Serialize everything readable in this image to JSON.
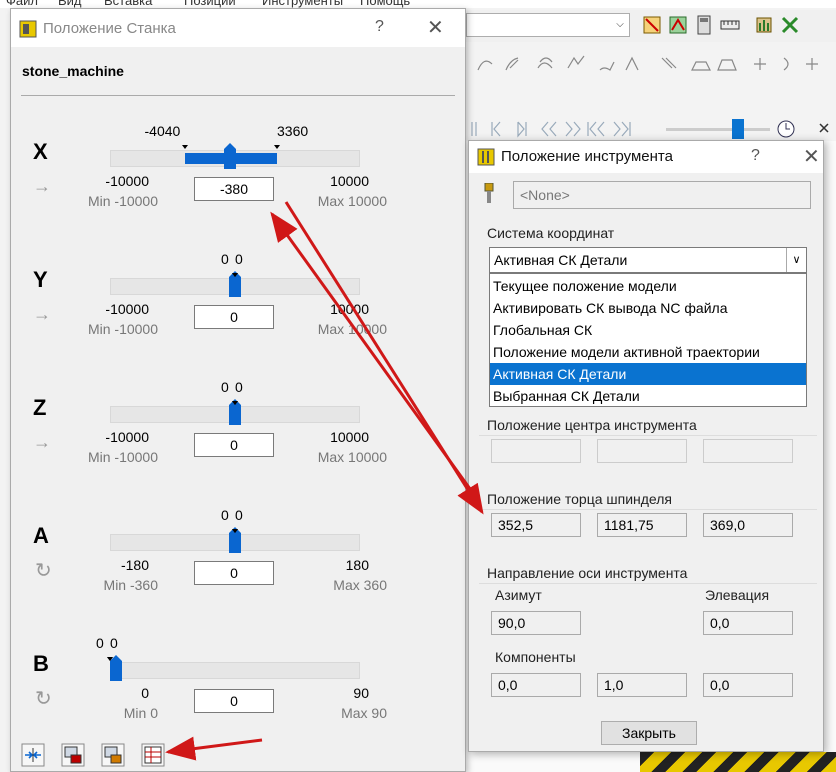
{
  "colors": {
    "accent": "#0a66d0",
    "selection": "#0a73d0",
    "arrow": "#d01818"
  },
  "background_app": {
    "menu_items": [
      "Файл",
      "Вид",
      "Вставка",
      "Позиции",
      "Инструменты",
      "Помощь"
    ]
  },
  "machine_dialog": {
    "title": "Положение Станка",
    "help": "?",
    "close": "✕",
    "machine_name": "stone_machine",
    "axes": [
      {
        "name": "X",
        "kind": "linear",
        "range_low": "-4040",
        "range_high": "3360",
        "limit_low": "-10000",
        "limit_high": "10000",
        "min_label": "Min -10000",
        "max_label": "Max 10000",
        "value": "-380",
        "value_num": -380,
        "min": -10000,
        "max": 10000,
        "range_low_num": -4040,
        "range_high_num": 3360
      },
      {
        "name": "Y",
        "kind": "linear",
        "range_low": "0",
        "range_high": "0",
        "limit_low": "-10000",
        "limit_high": "10000",
        "min_label": "Min -10000",
        "max_label": "Max 10000",
        "value": "0",
        "value_num": 0,
        "min": -10000,
        "max": 10000
      },
      {
        "name": "Z",
        "kind": "linear",
        "range_low": "0",
        "range_high": "0",
        "limit_low": "-10000",
        "limit_high": "10000",
        "min_label": "Min -10000",
        "max_label": "Max 10000",
        "value": "0",
        "value_num": 0,
        "min": -10000,
        "max": 10000
      },
      {
        "name": "A",
        "kind": "rotary",
        "range_low": "0",
        "range_high": "0",
        "limit_low": "-180",
        "limit_high": "180",
        "min_label": "Min -360",
        "max_label": "Max 360",
        "value": "0",
        "value_num": 0,
        "min": -180,
        "max": 180
      },
      {
        "name": "B",
        "kind": "rotary",
        "range_low": "0",
        "range_high": "0",
        "limit_low": "0",
        "limit_high": "90",
        "min_label": "Min 0",
        "max_label": "Max 90",
        "value": "0",
        "value_num": 0,
        "min": 0,
        "max": 90
      }
    ],
    "bottom_buttons": [
      "align-icon",
      "machine-to-model-icon",
      "model-to-machine-icon",
      "position-table-icon"
    ]
  },
  "tool_dialog": {
    "title": "Положение инструмента",
    "help": "?",
    "close": "✕",
    "tool_name": "<None>",
    "coord_system_label": "Система координат",
    "coord_system_selected": "Активная СК Детали",
    "coord_system_options": [
      "Текущее положение модели",
      "Активировать СК вывода NC файла",
      "Глобальная СК",
      "Положение модели активной траектории",
      "Активная СК Детали",
      "Выбранная СК Детали"
    ],
    "tool_center_label": "Положение центра инструмента",
    "tool_center_values": [
      "",
      "",
      ""
    ],
    "spindle_face_label": "Положение торца шпинделя",
    "spindle_face_values": [
      "352,5",
      "1181,75",
      "369,0"
    ],
    "axis_direction_label": "Направление оси инструмента",
    "azimuth_label": "Азимут",
    "azimuth_value": "90,0",
    "elevation_label": "Элевация",
    "elevation_value": "0,0",
    "components_label": "Компоненты",
    "components_values": [
      "0,0",
      "1,0",
      "0,0"
    ],
    "close_button": "Закрыть"
  }
}
